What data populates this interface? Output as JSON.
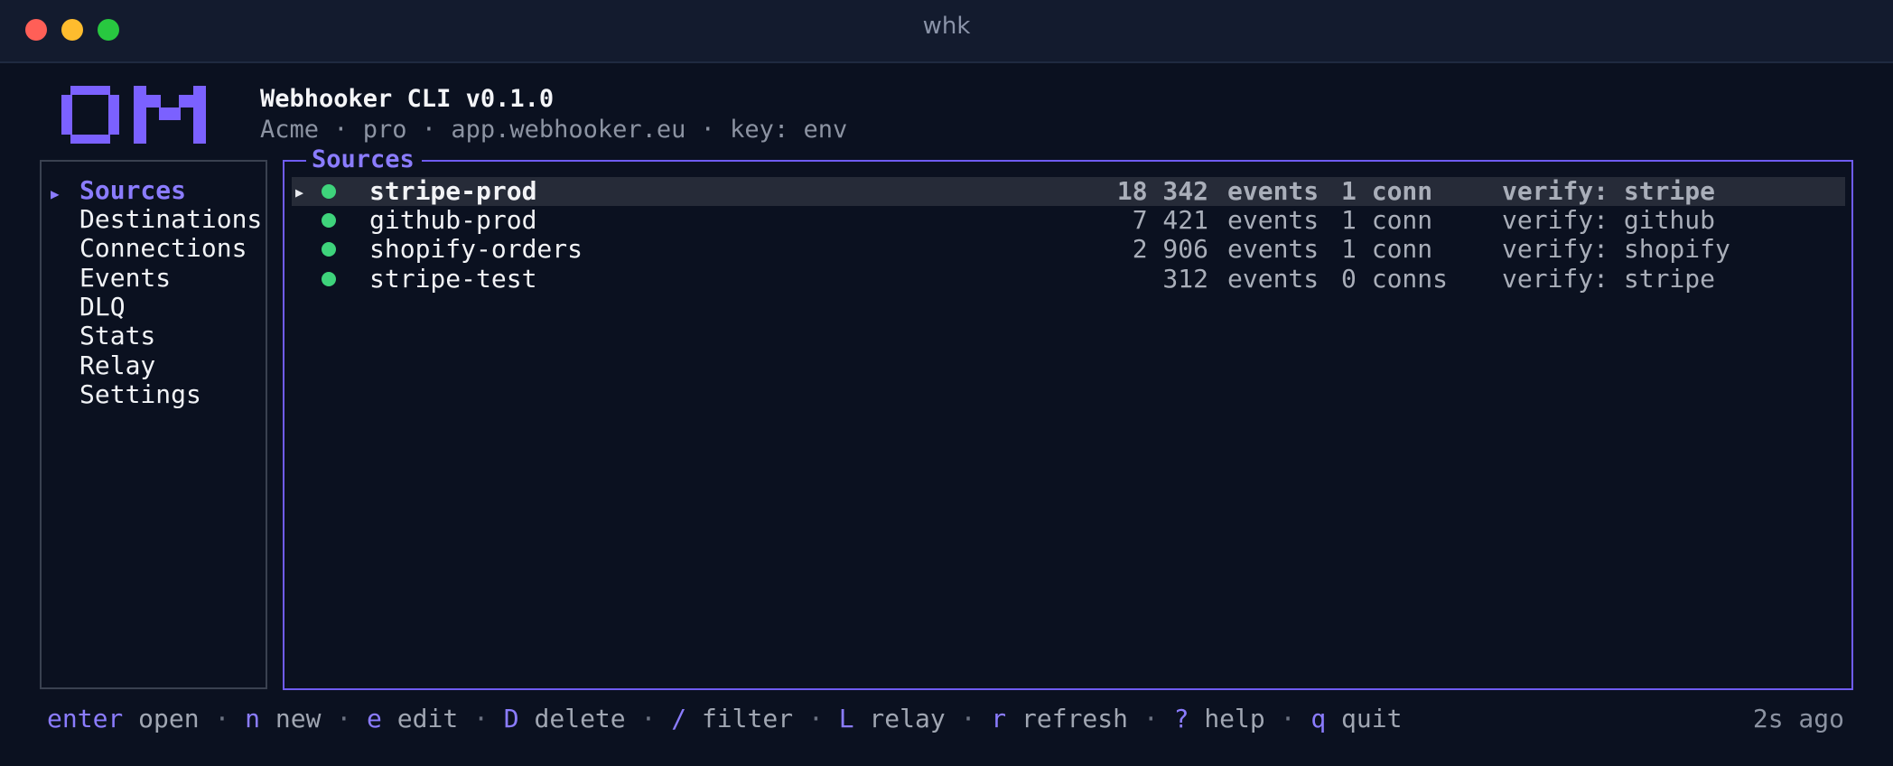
{
  "window": {
    "title": "whk"
  },
  "header": {
    "title": "Webhooker CLI v0.1.0",
    "subtitle": "Acme · pro · app.webhooker.eu · key: env"
  },
  "sidebar": {
    "items": [
      {
        "label": "Sources",
        "active": true
      },
      {
        "label": "Destinations"
      },
      {
        "label": "Connections"
      },
      {
        "label": "Events"
      },
      {
        "label": "DLQ"
      },
      {
        "label": "Stats"
      },
      {
        "label": "Relay"
      },
      {
        "label": "Settings"
      }
    ]
  },
  "panel": {
    "title": "Sources",
    "rows": [
      {
        "name": "stripe-prod",
        "events": "18 342",
        "events_label": "events",
        "conns": "1 conn",
        "verify": "verify: stripe",
        "status": "active",
        "selected": true
      },
      {
        "name": "github-prod",
        "events": "7 421",
        "events_label": "events",
        "conns": "1 conn",
        "verify": "verify: github",
        "status": "active"
      },
      {
        "name": "shopify-orders",
        "events": "2 906",
        "events_label": "events",
        "conns": "1 conn",
        "verify": "verify: shopify",
        "status": "active"
      },
      {
        "name": "stripe-test",
        "events": "312",
        "events_label": "events",
        "conns": "0 conns",
        "verify": "verify: stripe",
        "status": "active"
      }
    ]
  },
  "footer": {
    "hints": [
      {
        "key": "enter",
        "label": "open"
      },
      {
        "key": "n",
        "label": "new"
      },
      {
        "key": "e",
        "label": "edit"
      },
      {
        "key": "D",
        "label": "delete"
      },
      {
        "key": "/",
        "label": "filter"
      },
      {
        "key": "L",
        "label": "relay"
      },
      {
        "key": "r",
        "label": "refresh"
      },
      {
        "key": "?",
        "label": "help"
      },
      {
        "key": "q",
        "label": "quit"
      }
    ],
    "separator": "·",
    "updated": "2s ago"
  },
  "colors": {
    "accent": "#8b7cff",
    "background": "#0b1120",
    "status_active": "#3ed37b"
  }
}
